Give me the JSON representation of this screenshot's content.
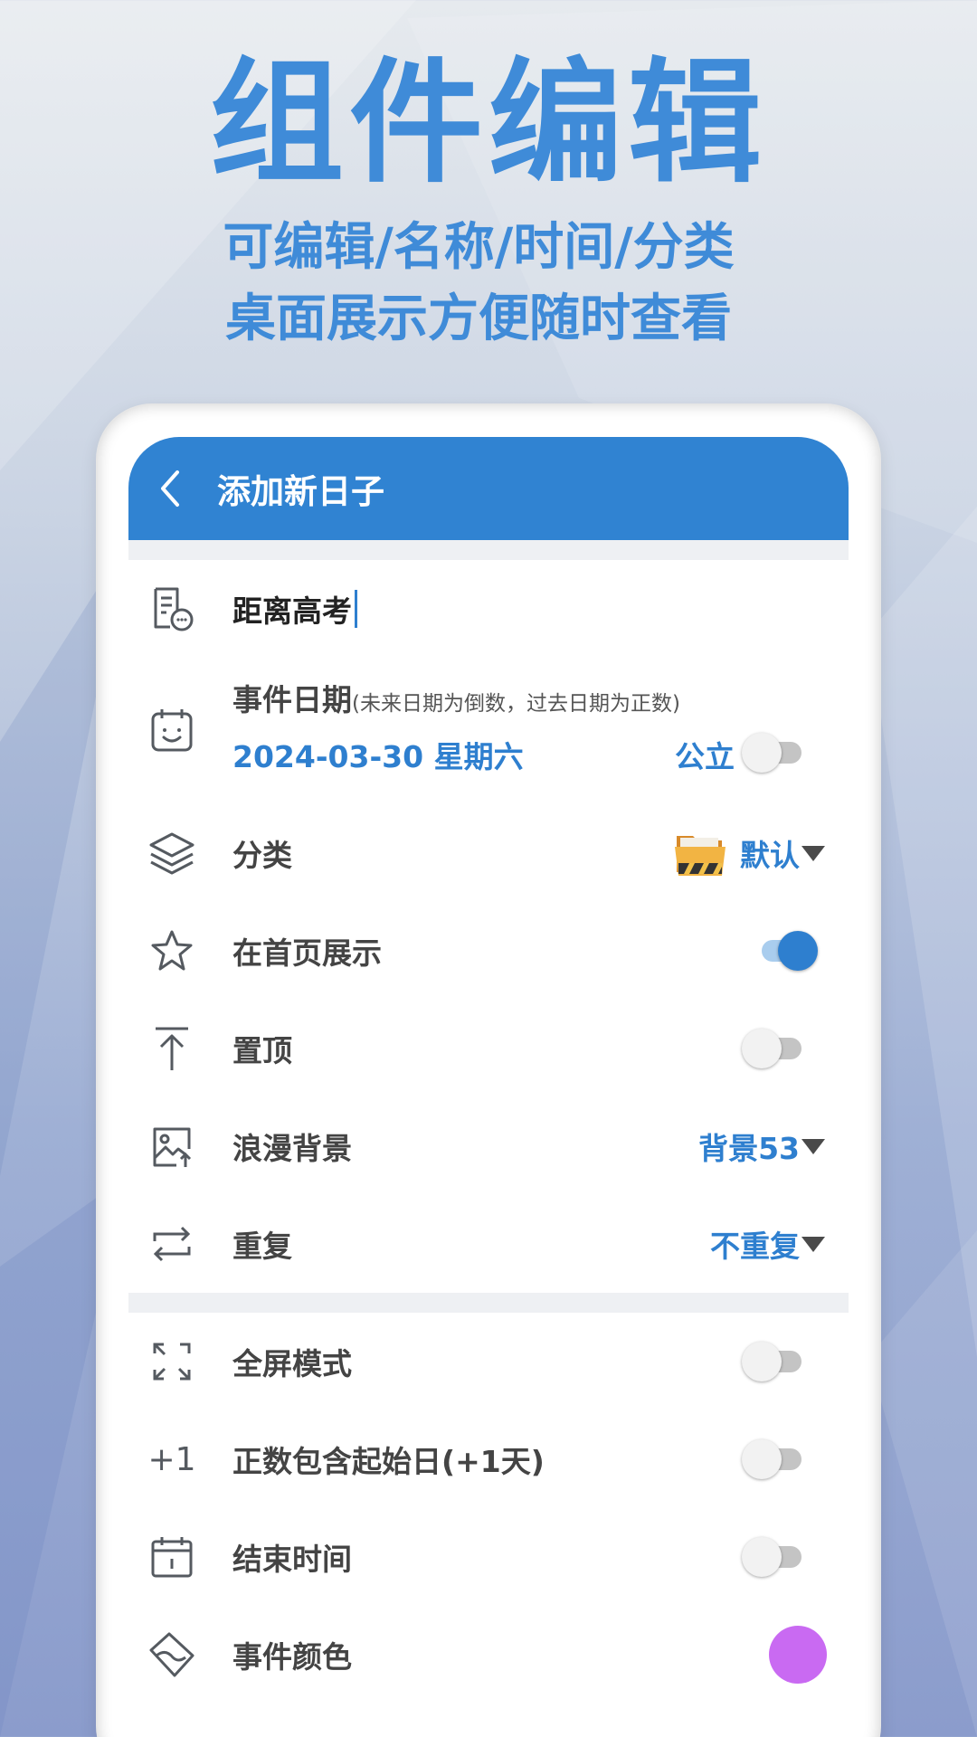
{
  "promo": {
    "title": "组件编辑",
    "subtitle_line1": "可编辑/名称/时间/分类",
    "subtitle_line2": "桌面展示方便随时查看"
  },
  "appbar": {
    "back_icon": "chevron-left-icon",
    "title": "添加新日子"
  },
  "form": {
    "name_value": "距离高考",
    "event_date": {
      "label": "事件日期",
      "hint": "(未来日期为倒数，过去日期为正数)",
      "value": "2024-03-30 星期六",
      "calendar_type": "公立",
      "lunar_enabled": false
    },
    "category": {
      "label": "分类",
      "value": "默认",
      "icon": "folder-icon"
    },
    "show_on_home": {
      "label": "在首页展示",
      "enabled": true
    },
    "pin_top": {
      "label": "置顶",
      "enabled": false
    },
    "background": {
      "label": "浪漫背景",
      "value": "背景53"
    },
    "repeat": {
      "label": "重复",
      "value": "不重复"
    },
    "fullscreen": {
      "label": "全屏模式",
      "enabled": false
    },
    "include_start": {
      "icon_text": "+1",
      "label": "正数包含起始日(+1天)",
      "enabled": false
    },
    "end_time": {
      "label": "结束时间",
      "enabled": false
    },
    "event_color": {
      "label": "事件颜色",
      "color": "#c96af2"
    }
  },
  "colors": {
    "accent": "#3083d2",
    "promo_text": "#3f8bd8"
  }
}
